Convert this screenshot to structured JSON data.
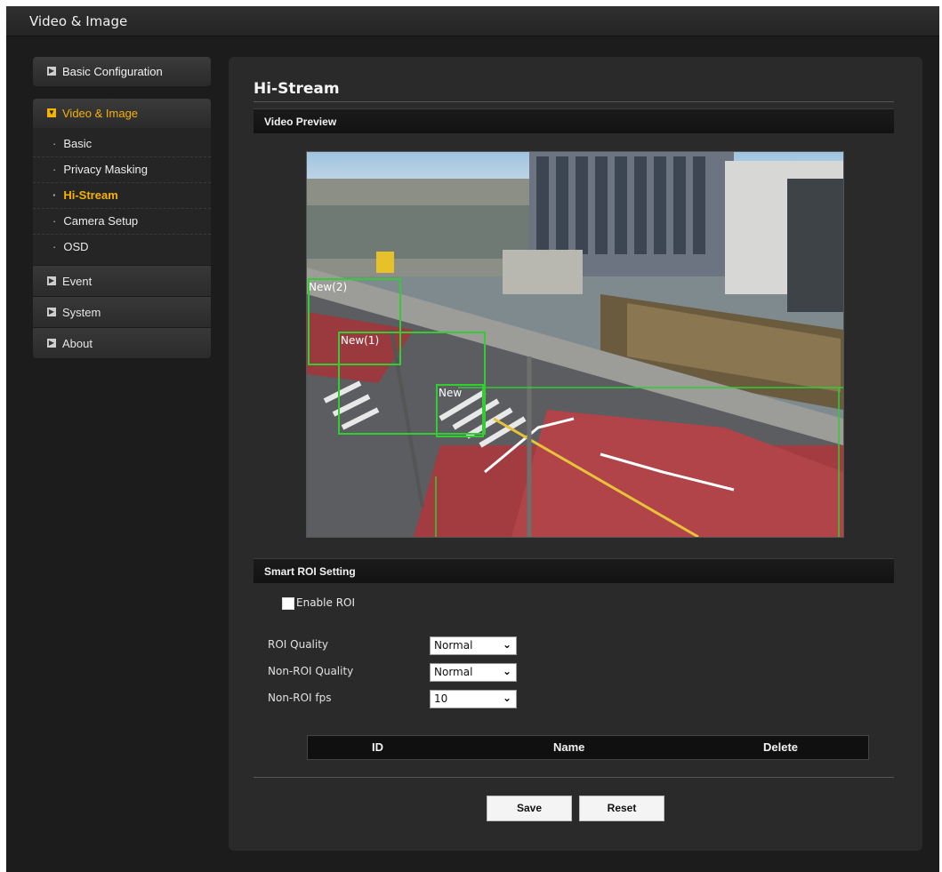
{
  "window": {
    "title": "Video & Image"
  },
  "sidebar": {
    "basic_config": "Basic Configuration",
    "video_image": "Video & Image",
    "sub_items": [
      "Basic",
      "Privacy Masking",
      "Hi-Stream",
      "Camera Setup",
      "OSD"
    ],
    "current_sub": "Hi-Stream",
    "event": "Event",
    "system": "System",
    "about": "About"
  },
  "main": {
    "page_title": "Hi-Stream",
    "video_preview_header": "Video Preview",
    "roi_boxes": [
      "New(2)",
      "New(1)",
      "New"
    ],
    "smart_roi_header": "Smart ROI Setting",
    "enable_roi_label": "Enable ROI",
    "enable_roi_checked": false,
    "roi_quality_label": "ROI Quality",
    "roi_quality_value": "Normal",
    "non_roi_quality_label": "Non-ROI Quality",
    "non_roi_quality_value": "Normal",
    "non_roi_fps_label": "Non-ROI fps",
    "non_roi_fps_value": "10",
    "table_headers": [
      "ID",
      "Name",
      "Delete"
    ],
    "save_label": "Save",
    "reset_label": "Reset"
  },
  "colors": {
    "accent": "#f6b200",
    "roi_box": "#33cc33"
  }
}
